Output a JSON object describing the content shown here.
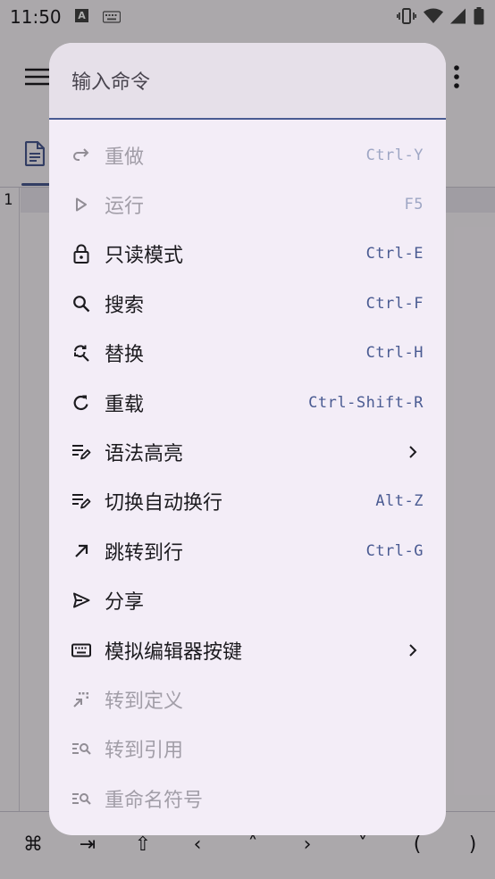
{
  "status_bar": {
    "time": "11:50",
    "notification_badge": "A",
    "icons": [
      "notification-a-icon",
      "keyboard-icon",
      "vibrate-icon",
      "wifi-icon",
      "signal-icon",
      "battery-icon"
    ]
  },
  "editor": {
    "line_numbers": [
      "1"
    ]
  },
  "symbol_bar": {
    "keys": [
      "⌘",
      "⇥",
      "⇧",
      "‹",
      "˄",
      "›",
      "˅",
      "(",
      ")"
    ]
  },
  "command_palette": {
    "input_placeholder": "输入命令",
    "input_value": "",
    "items": [
      {
        "label": "重做",
        "shortcut": "Ctrl-Y",
        "icon": "redo-icon",
        "enabled": false
      },
      {
        "label": "运行",
        "shortcut": "F5",
        "icon": "play-icon",
        "enabled": false
      },
      {
        "label": "只读模式",
        "shortcut": "Ctrl-E",
        "icon": "lock-icon",
        "enabled": true
      },
      {
        "label": "搜索",
        "shortcut": "Ctrl-F",
        "icon": "search-icon",
        "enabled": true
      },
      {
        "label": "替换",
        "shortcut": "Ctrl-H",
        "icon": "find-replace-icon",
        "enabled": true
      },
      {
        "label": "重载",
        "shortcut": "Ctrl-Shift-R",
        "icon": "reload-icon",
        "enabled": true
      },
      {
        "label": "语法高亮",
        "shortcut": "",
        "icon": "edit-note-icon",
        "enabled": true,
        "submenu": true
      },
      {
        "label": "切换自动换行",
        "shortcut": "Alt-Z",
        "icon": "edit-note-icon",
        "enabled": true
      },
      {
        "label": "跳转到行",
        "shortcut": "Ctrl-G",
        "icon": "arrow-up-right-icon",
        "enabled": true
      },
      {
        "label": "分享",
        "shortcut": "",
        "icon": "share-send-icon",
        "enabled": true
      },
      {
        "label": "模拟编辑器按键",
        "shortcut": "",
        "icon": "keyboard-icon",
        "enabled": true,
        "submenu": true
      },
      {
        "label": "转到定义",
        "shortcut": "",
        "icon": "go-to-definition-icon",
        "enabled": false
      },
      {
        "label": "转到引用",
        "shortcut": "",
        "icon": "find-references-icon",
        "enabled": false
      },
      {
        "label": "重命名符号",
        "shortcut": "",
        "icon": "find-references-icon",
        "enabled": false
      }
    ]
  },
  "colors": {
    "accent": "#4a5b92",
    "dialog_bg": "#f3edf7",
    "input_bg": "#e6e0e9",
    "text": "#1c1b1f",
    "disabled_text": "#a29ea8"
  }
}
